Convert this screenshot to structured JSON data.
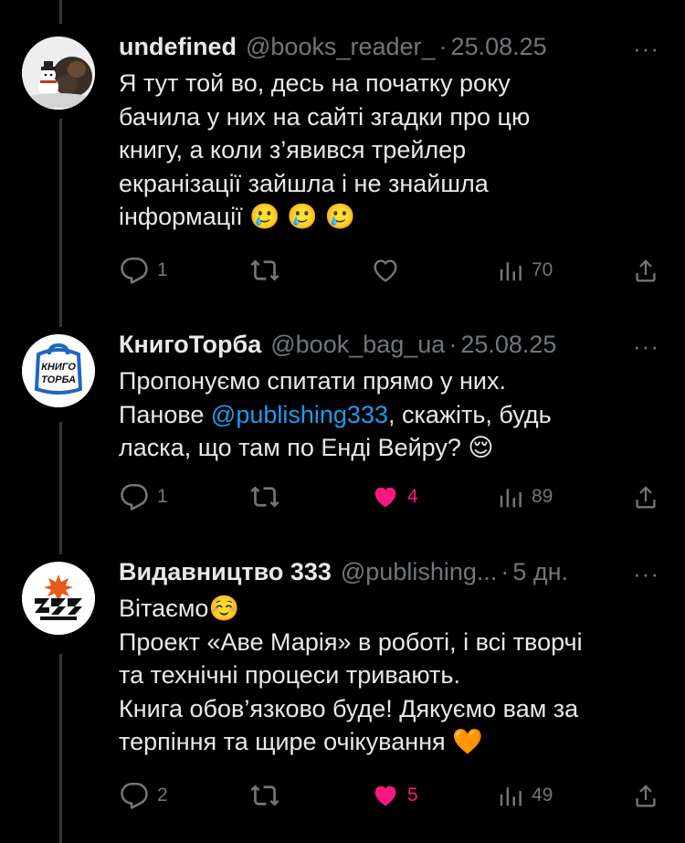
{
  "posts": [
    {
      "name": "undefined",
      "handle": "@books_reader_",
      "sep": "·",
      "date": "25.08.25",
      "more": "···",
      "lines": [
        "Я тут той во, десь на початку року",
        "бачила у них на сайті згадки про цю",
        "книгу, а коли з’явився трейлер",
        "екранізації зайшла і не знайшла",
        "інформації 🥲 🥲 🥲"
      ],
      "replies": "1",
      "reposts": "",
      "likes": "",
      "liked": false,
      "views": "70"
    },
    {
      "name": "КнигоТорба",
      "handle": "@book_bag_ua",
      "sep": "·",
      "date": "25.08.25",
      "more": "···",
      "line1": "Пропонуємо спитати прямо у них.",
      "line2_prefix": "Панове ",
      "mention": "@publishing333",
      "line2_suffix": ", скажіть, будь",
      "line3": "ласка, що там по Енді Вейру? 😌",
      "avatar_text_1": "КНИГО",
      "avatar_text_2": "ТОРБА",
      "replies": "1",
      "reposts": "",
      "likes": "4",
      "liked": true,
      "views": "89"
    },
    {
      "name": "Видавництво 333",
      "handle": "@publishing...",
      "sep": "·",
      "date": "5 дн.",
      "more": "···",
      "lines": [
        "Вітаємо☺️",
        "Проект «Аве Марія» в роботі, і всі творчі",
        "та технічні процеси тривають.",
        "Книга обов’язково буде! Дякуємо вам за",
        "терпіння та щире очікування 🧡"
      ],
      "replies": "2",
      "reposts": "",
      "likes": "5",
      "liked": true,
      "views": "49"
    }
  ],
  "colors": {
    "background": "#000000",
    "text": "#e7e9ea",
    "muted": "#71767b",
    "link": "#1d9bf0",
    "like": "#f91880",
    "thread_line": "#333639"
  }
}
